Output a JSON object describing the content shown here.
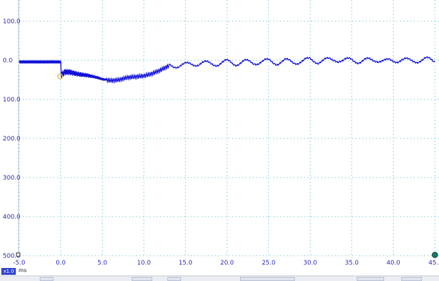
{
  "chart_data": {
    "type": "line",
    "title": "",
    "xlabel": "",
    "ylabel": "",
    "x_unit": "ms",
    "xlim": [
      -5.0,
      45.0
    ],
    "ylim": [
      -500.0,
      100.0
    ],
    "y_inverted": true,
    "xticks": [
      -5.0,
      0.0,
      5.0,
      10.0,
      15.0,
      20.0,
      25.0,
      30.0,
      35.0,
      40.0,
      45.0
    ],
    "xtick_labels": [
      "-5.0",
      "0.0",
      "5.0",
      "10.0",
      "15.0",
      "20.0",
      "25.0",
      "30.0",
      "35.0",
      "40.0",
      "45."
    ],
    "yticks": [
      100.0,
      0.0,
      -100.0,
      -200.0,
      -300.0,
      -400.0,
      -500.0
    ],
    "ytick_labels": [
      "100.0",
      "0.0",
      "100.0",
      "200.0",
      "300.0",
      "400.0",
      "500.0"
    ],
    "grid": true,
    "series_color": "#1010d8",
    "series": [
      {
        "x": [
          -5.0,
          -4.0,
          -3.0,
          -2.0,
          -1.0,
          0.0,
          0.05,
          0.5,
          1.0,
          2.0,
          3.0,
          4.0,
          5.0,
          6.0,
          7.0,
          8.0,
          9.0,
          10.0,
          11.0,
          12.0,
          13.0,
          14.0,
          15.0,
          16.0,
          17.0,
          18.0,
          19.0,
          20.0,
          21.0,
          22.0,
          23.0,
          24.0,
          25.0,
          26.0,
          27.0,
          28.0,
          29.0,
          30.0,
          31.0,
          32.0,
          33.0,
          34.0,
          35.0,
          36.0,
          37.0,
          38.0,
          39.0,
          40.0,
          41.0,
          42.0,
          43.0,
          44.0,
          45.0
        ],
        "y": [
          -4,
          -4,
          -4,
          -4,
          -4,
          -4,
          -38,
          -30,
          -30,
          -35,
          -38,
          -42,
          -48,
          -52,
          -50,
          -44,
          -42,
          -40,
          -34,
          -25,
          -14,
          -13,
          -12,
          -9,
          -7,
          -9,
          -8,
          -4,
          -8,
          -4,
          -6,
          -4,
          -2,
          -6,
          -2,
          -4,
          -3,
          2,
          -3,
          0,
          3,
          -2,
          2,
          -3,
          0,
          2,
          -3,
          -1,
          2,
          -2,
          0,
          2,
          -1
        ]
      }
    ]
  },
  "cursor": {
    "scale_badge": "x1.0",
    "unit": "ms"
  },
  "colors": {
    "grid": "#9fd3dc",
    "axis_text": "#2a2ab8",
    "trace": "#1010d8",
    "marker_end": "#1a7a6a",
    "marker_start": "#d8c060"
  }
}
